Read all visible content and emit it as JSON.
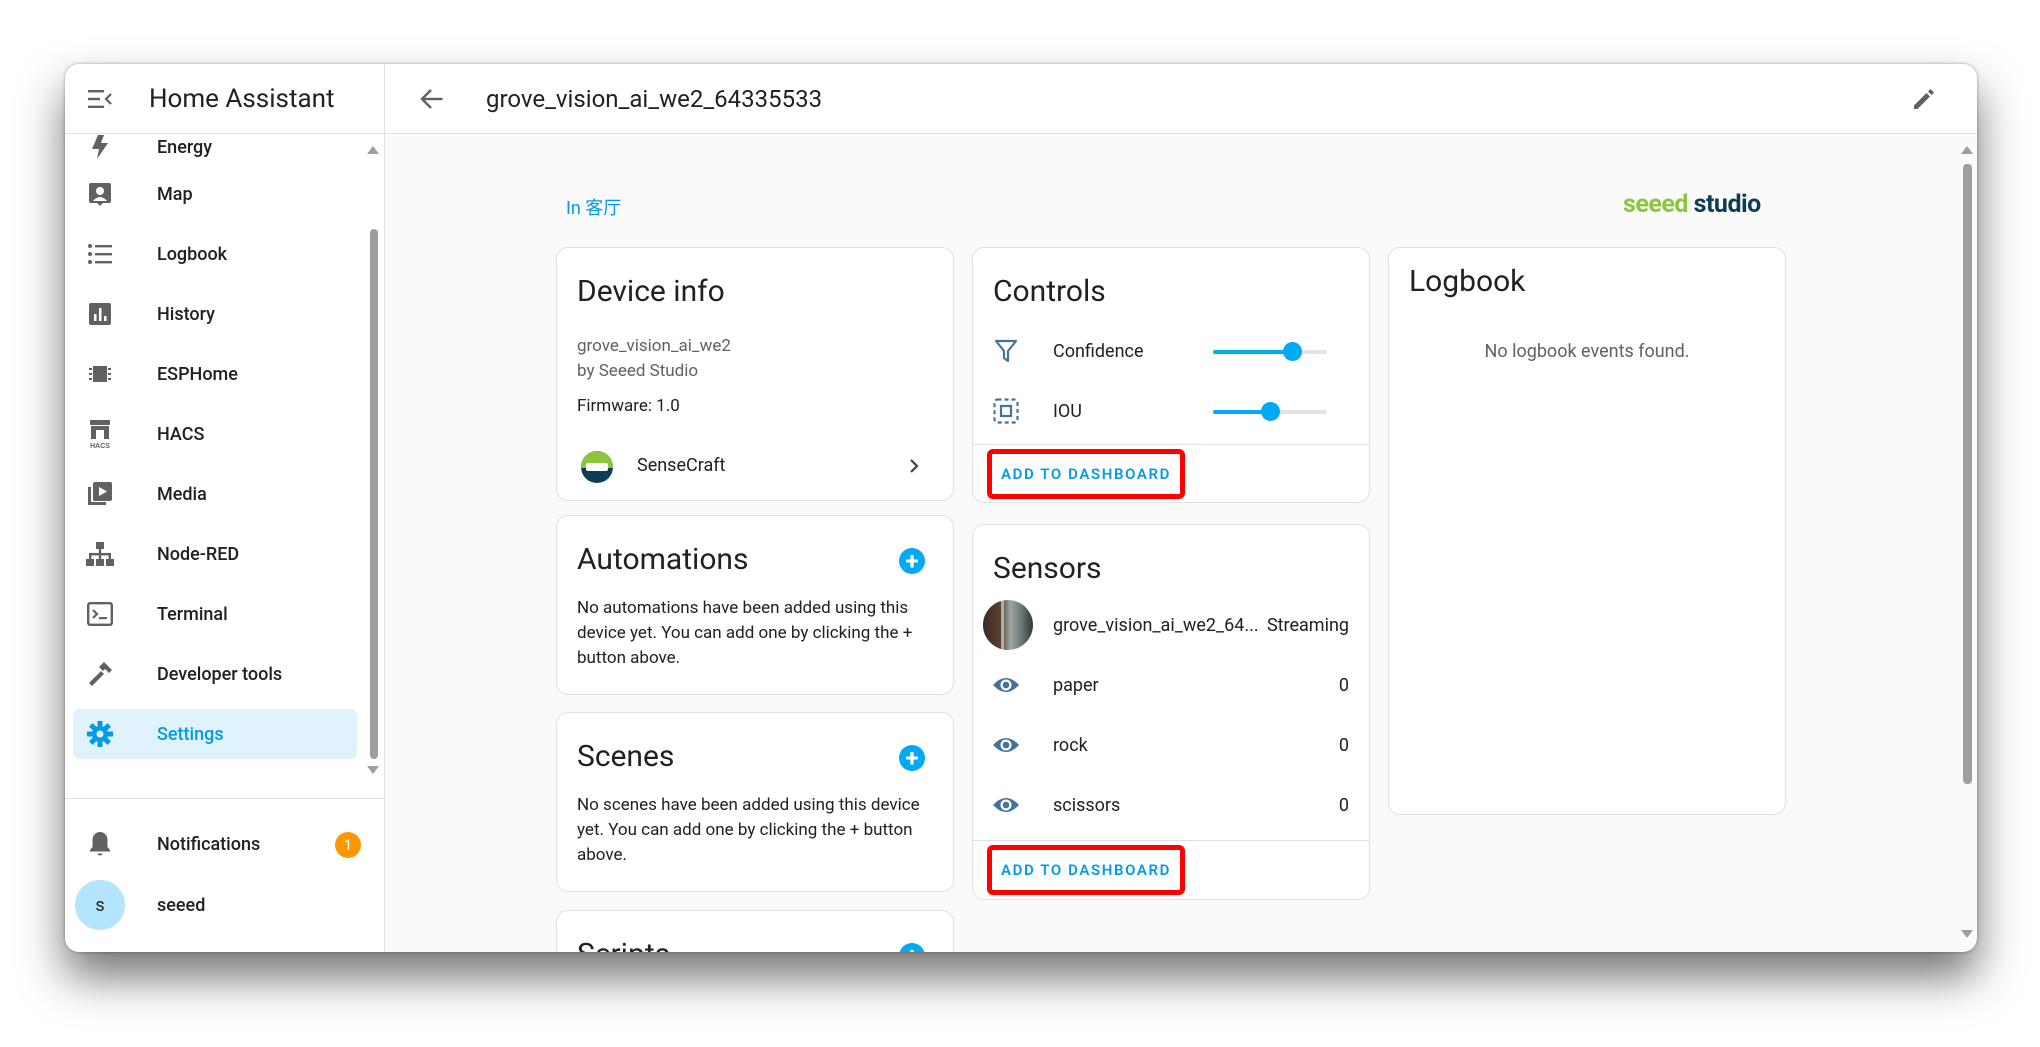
{
  "sidebar": {
    "title": "Home Assistant",
    "items": [
      {
        "label": "Energy",
        "icon": "lightning-bolt-icon"
      },
      {
        "label": "Map",
        "icon": "map-account-icon"
      },
      {
        "label": "Logbook",
        "icon": "format-list-bulleted-icon"
      },
      {
        "label": "History",
        "icon": "chart-box-icon"
      },
      {
        "label": "ESPHome",
        "icon": "chip-icon"
      },
      {
        "label": "HACS",
        "icon": "hacs-icon"
      },
      {
        "label": "Media",
        "icon": "play-box-multiple-icon"
      },
      {
        "label": "Node-RED",
        "icon": "sitemap-icon"
      },
      {
        "label": "Terminal",
        "icon": "console-icon"
      },
      {
        "label": "Developer tools",
        "icon": "hammer-icon"
      },
      {
        "label": "Settings",
        "icon": "cog-icon",
        "active": true
      }
    ],
    "notifications": {
      "label": "Notifications",
      "count": "1"
    },
    "user": {
      "name": "seeed",
      "initial": "s"
    }
  },
  "header": {
    "title": "grove_vision_ai_we2_64335533"
  },
  "area": "In 客厅",
  "brand": {
    "part1": "seeed",
    "part2": " studio"
  },
  "device_info": {
    "title": "Device info",
    "model": "grove_vision_ai_we2",
    "manufacturer": "by Seeed Studio",
    "firmware": "Firmware: 1.0",
    "integration": "SenseCraft"
  },
  "automations": {
    "title": "Automations",
    "text": "No automations have been added using this device yet. You can add one by clicking the + button above."
  },
  "scenes": {
    "title": "Scenes",
    "text": "No scenes have been added using this device yet. You can add one by clicking the + button above."
  },
  "scripts": {
    "title": "Scripts"
  },
  "controls": {
    "title": "Controls",
    "items": [
      {
        "name": "Confidence",
        "icon": "filter-icon",
        "value_fraction": 0.7
      },
      {
        "name": "IOU",
        "icon": "select-group-icon",
        "value_fraction": 0.5
      }
    ],
    "action": "ADD TO DASHBOARD"
  },
  "sensors": {
    "title": "Sensors",
    "items": [
      {
        "name": "grove_vision_ai_we2_64...",
        "value": "Streaming",
        "icon": "camera-thumbnail"
      },
      {
        "name": "paper",
        "value": "0",
        "icon": "eye-icon"
      },
      {
        "name": "rock",
        "value": "0",
        "icon": "eye-icon"
      },
      {
        "name": "scissors",
        "value": "0",
        "icon": "eye-icon"
      }
    ],
    "action": "ADD TO DASHBOARD"
  },
  "logbook": {
    "title": "Logbook",
    "empty": "No logbook events found."
  },
  "colors": {
    "accent": "#03a9f4",
    "link": "#039be5",
    "badge": "#ff9800",
    "highlight_box": "#ff0000"
  }
}
